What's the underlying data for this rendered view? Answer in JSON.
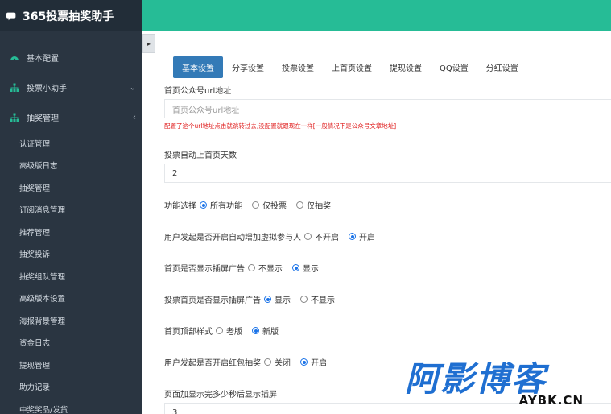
{
  "sidebar": {
    "brand": "365投票抽奖助手",
    "menu": [
      {
        "label": "基本配置",
        "icon": "dashboard-icon"
      },
      {
        "label": "投票小助手",
        "icon": "sitemap-icon",
        "chevron": "⌄"
      },
      {
        "label": "抽奖管理",
        "icon": "sitemap-icon",
        "chevron": "‹"
      }
    ],
    "submenu": [
      "认证管理",
      "高级版日志",
      "抽奖管理",
      "订阅消息管理",
      "推荐管理",
      "抽奖投诉",
      "抽奖组队管理",
      "高级版本设置",
      "海报背景管理",
      "资金日志",
      "提现管理",
      "助力记录",
      "中奖奖品/发货"
    ]
  },
  "toggle": "▸",
  "tabs": [
    "基本设置",
    "分享设置",
    "投票设置",
    "上首页设置",
    "提现设置",
    "QQ设置",
    "分红设置"
  ],
  "form": {
    "url_label": "首页公众号url地址",
    "url_placeholder": "首页公众号url地址",
    "url_hint": "配置了这个url地址点击就跳转过去,没配置就跟现在一样[一般情况下是公众号文章地址]",
    "days_label": "投票自动上首页天数",
    "days_value": "2",
    "func_label": "功能选择",
    "func_opts": [
      "所有功能",
      "仅投票",
      "仅抽奖"
    ],
    "virtual_label": "用户发起是否开启自动增加虚拟参与人",
    "virtual_opts": [
      "不开启",
      "开启"
    ],
    "home_ad_label": "首页是否显示插屏广告",
    "home_ad_opts": [
      "不显示",
      "显示"
    ],
    "vote_ad_label": "投票首页是否显示插屏广告",
    "vote_ad_opts": [
      "显示",
      "不显示"
    ],
    "style_label": "首页顶部样式",
    "style_opts": [
      "老版",
      "新版"
    ],
    "redpack_label": "用户发起是否开启红包抽奖",
    "redpack_opts": [
      "关闭",
      "开启"
    ],
    "delay_label": "页面加显示完多少秒后显示插屏",
    "delay_value": "3"
  },
  "watermark": {
    "main": "阿影博客",
    "sub": "AYBK.CN"
  }
}
